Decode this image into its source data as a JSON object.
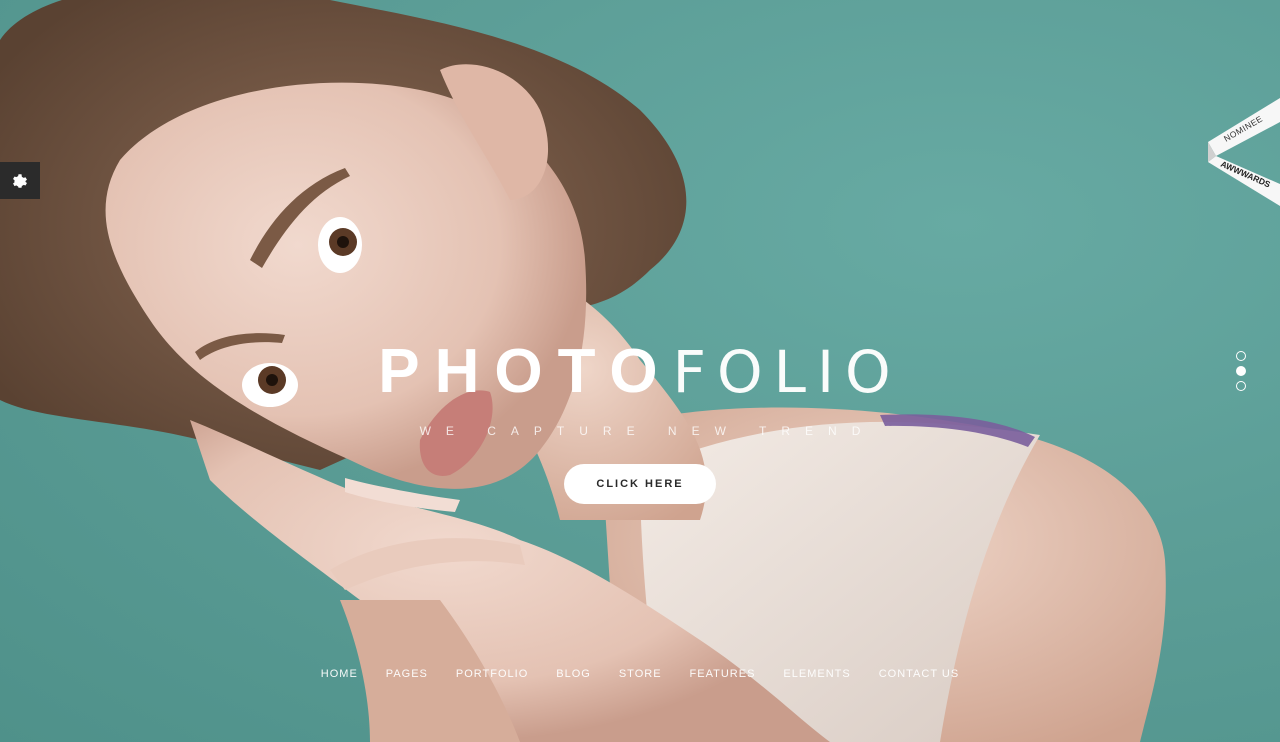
{
  "hero": {
    "brand_bold": "PHOTO",
    "brand_light": "FOLIO",
    "tagline": "WE CAPTURE NEW TREND",
    "cta_label": "CLICK HERE",
    "background_color": "#5c9e97",
    "photo_description_icon": "woman-portrait-image"
  },
  "settings": {
    "icon": "gear-icon",
    "background": "#2b2b2b"
  },
  "award": {
    "line1": "NOMINEE",
    "line2": "AWWWARDS"
  },
  "slider": {
    "count": 3,
    "active": 1
  },
  "nav": {
    "items": [
      "HOME",
      "PAGES",
      "PORTFOLIO",
      "BLOG",
      "STORE",
      "FEATURES",
      "ELEMENTS",
      "CONTACT US"
    ]
  }
}
